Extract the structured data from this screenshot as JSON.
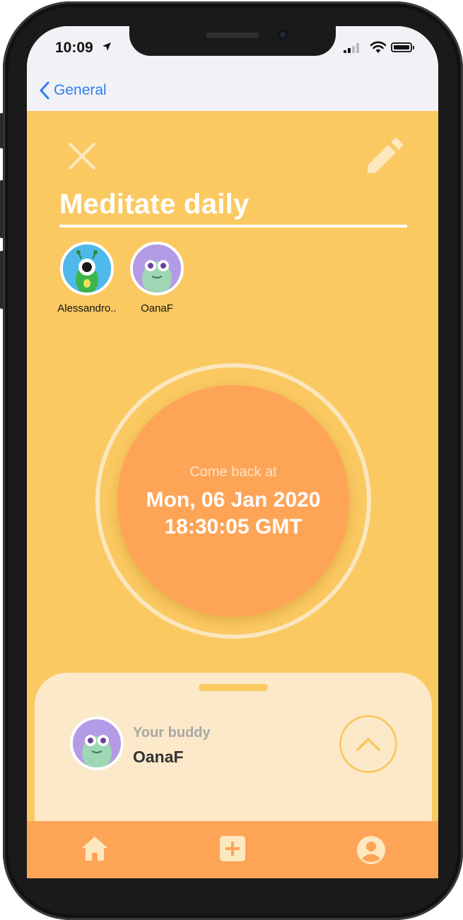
{
  "status_bar": {
    "time": "10:09"
  },
  "nav": {
    "back_label": "General"
  },
  "goal": {
    "title": "Meditate daily"
  },
  "members": [
    {
      "name": "Alessandro.."
    },
    {
      "name": "OanaF"
    }
  ],
  "timer": {
    "label": "Come back at",
    "date": "Mon, 06 Jan 2020",
    "time": "18:30:05 GMT"
  },
  "buddy": {
    "label": "Your buddy",
    "name": "OanaF"
  },
  "tabbar": {
    "items": [
      "home-icon",
      "add-icon",
      "profile-icon"
    ]
  },
  "colors": {
    "background": "#fbc962",
    "accent": "#fea457",
    "sheet": "#fbe9c9",
    "link": "#2f7df6"
  }
}
